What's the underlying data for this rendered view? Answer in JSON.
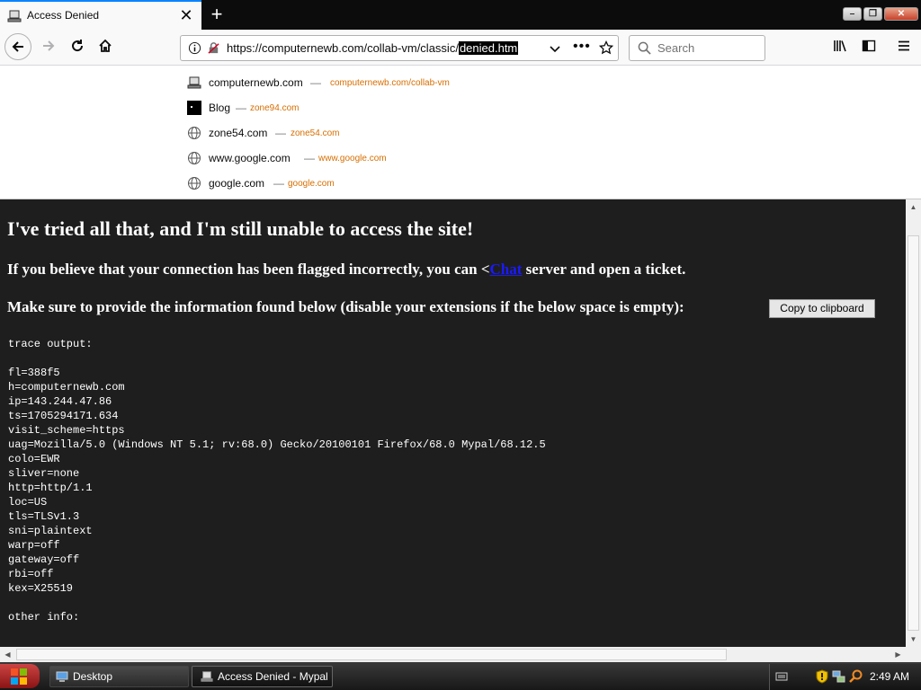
{
  "tab": {
    "title": "Access Denied"
  },
  "toolbar": {
    "url_prefix": "https://computernewb.com/collab-vm/classic/",
    "url_selected": "denied.htm",
    "search_placeholder": "Search"
  },
  "suggestions": [
    {
      "title": "computernewb.com",
      "url": "computernewb.com/collab-vm",
      "icon": "site-icon"
    },
    {
      "title": "Blog",
      "url": "zone94.com",
      "icon": "blog-icon"
    },
    {
      "title": "zone54.com",
      "url": "zone54.com",
      "icon": "globe-icon"
    },
    {
      "title": "www.google.com",
      "url": "www.google.com",
      "icon": "globe-icon"
    },
    {
      "title": "google.com",
      "url": "google.com",
      "icon": "globe-icon"
    }
  ],
  "separator": "—",
  "page": {
    "heading": "I've tried all that, and I'm still unable to access the site!",
    "flag_before": "If you believe that your connection has been flagged incorrectly, you can <",
    "flag_link": "Chat",
    "flag_after": " server and open a ticket.",
    "info_text": "Make sure to provide the information found below (disable your extensions if the below space is empty):",
    "copy_button": "Copy to clipboard",
    "trace": "trace output:\n\nfl=388f5\nh=computernewb.com\nip=143.244.47.86\nts=1705294171.634\nvisit_scheme=https\nuag=Mozilla/5.0 (Windows NT 5.1; rv:68.0) Gecko/20100101 Firefox/68.0 Mypal/68.12.5\ncolo=EWR\nsliver=none\nhttp=http/1.1\nloc=US\ntls=TLSv1.3\nsni=plaintext\nwarp=off\ngateway=off\nrbi=off\nkex=X25519\n\nother info:"
  },
  "taskbar": {
    "desktop_label": "Desktop",
    "browser_label": "Access Denied - Mypal",
    "clock": "2:49 AM"
  },
  "colors": {
    "accent": "#0a84ff",
    "link": "#1a1aff",
    "suggestion_url": "#d76e00",
    "page_bg": "#1e1e1e"
  }
}
